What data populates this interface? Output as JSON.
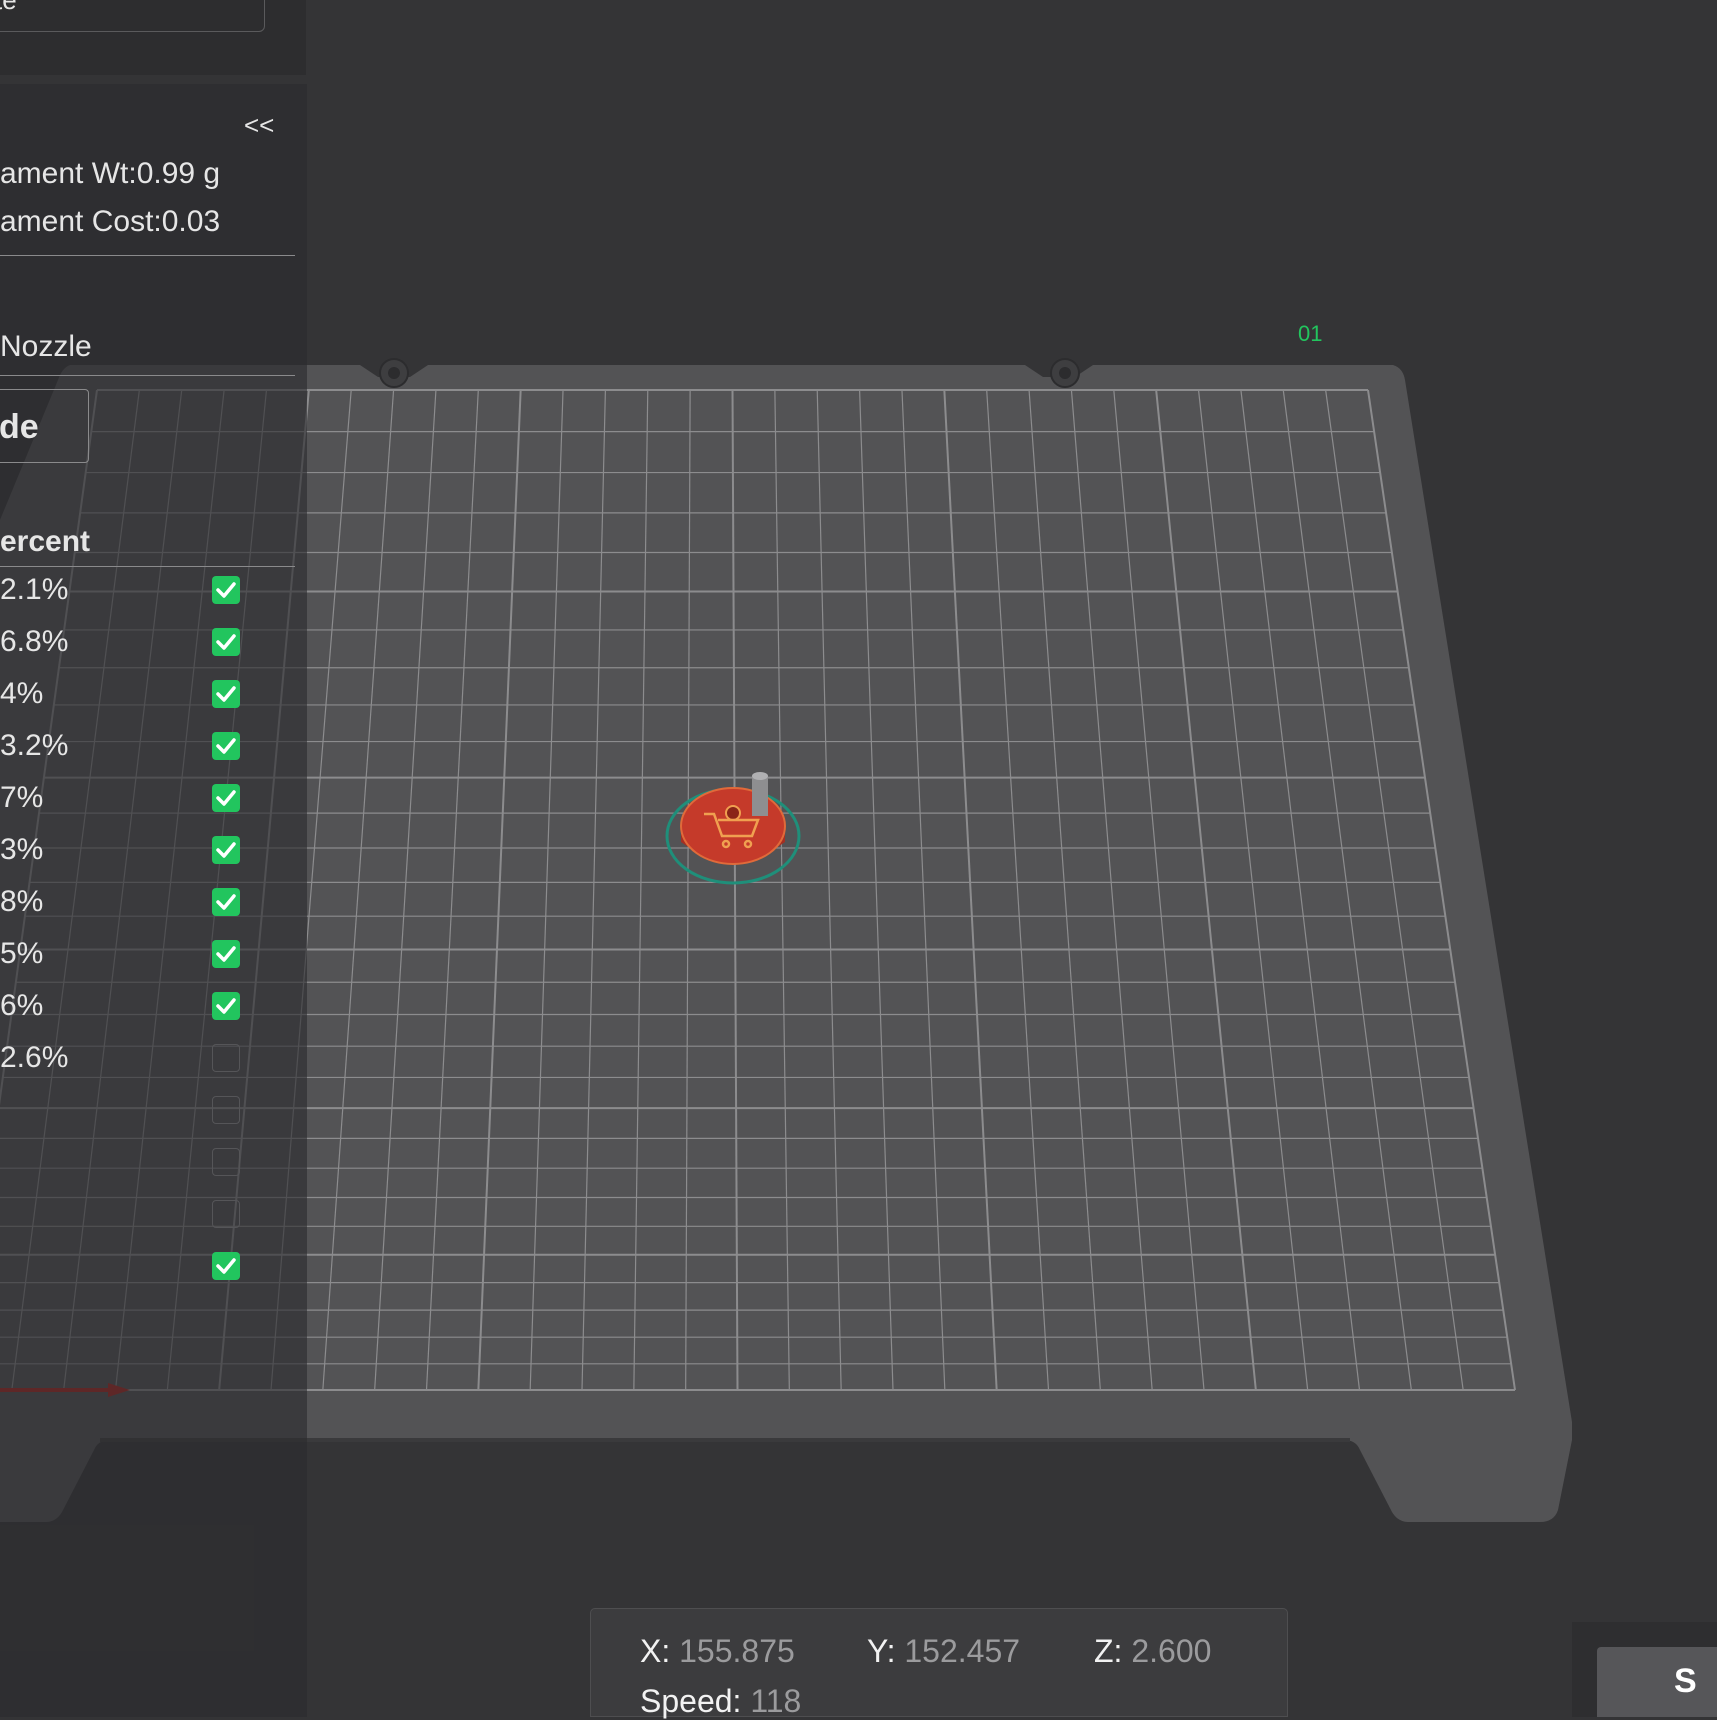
{
  "colors": {
    "accent": "#22c55e",
    "object": "#c0392b",
    "plate": "#535355",
    "background": "#343436"
  },
  "top_field": {
    "text": "te"
  },
  "sidebar": {
    "collapse_label": "<<",
    "filament_weight": "ament Wt:0.99 g",
    "filament_cost": "ament Cost:0.03",
    "nozzle_label": "Nozzle",
    "tab_label": "de",
    "percent_header": "ercent",
    "rows": [
      {
        "percent": "2.1%",
        "checked": true
      },
      {
        "percent": "6.8%",
        "checked": true
      },
      {
        "percent": "4%",
        "checked": true
      },
      {
        "percent": "3.2%",
        "checked": true
      },
      {
        "percent": "7%",
        "checked": true
      },
      {
        "percent": "3%",
        "checked": true
      },
      {
        "percent": "8%",
        "checked": true
      },
      {
        "percent": "5%",
        "checked": true
      },
      {
        "percent": "6%",
        "checked": true
      },
      {
        "percent": "2.6%",
        "checked": false
      },
      {
        "percent": "",
        "checked": false
      },
      {
        "percent": "",
        "checked": false
      },
      {
        "percent": "",
        "checked": false
      },
      {
        "percent": "",
        "checked": true
      }
    ]
  },
  "plate_label": "01",
  "readout": {
    "x_label": "X:",
    "x_value": "155.875",
    "y_label": "Y:",
    "y_value": "152.457",
    "z_label": "Z:",
    "z_value": "2.600",
    "speed_label": "Speed:",
    "speed_value": "118"
  },
  "corner_button": {
    "label": "S"
  }
}
